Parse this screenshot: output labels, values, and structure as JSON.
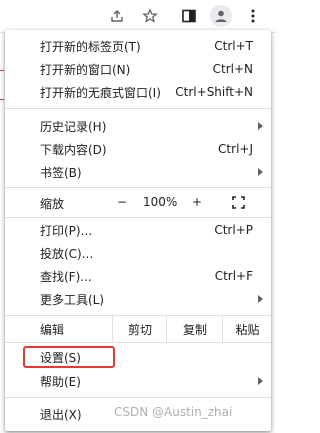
{
  "menu": {
    "new_tab": {
      "label": "打开新的标签页(T)",
      "shortcut": "Ctrl+T"
    },
    "new_window": {
      "label": "打开新的窗口(N)",
      "shortcut": "Ctrl+N"
    },
    "new_incognito": {
      "label": "打开新的无痕式窗口(I)",
      "shortcut": "Ctrl+Shift+N"
    },
    "history": {
      "label": "历史记录(H)"
    },
    "downloads": {
      "label": "下载内容(D)",
      "shortcut": "Ctrl+J"
    },
    "bookmarks": {
      "label": "书签(B)"
    },
    "zoom": {
      "label": "缩放",
      "minus": "−",
      "value": "100%",
      "plus": "+"
    },
    "print": {
      "label": "打印(P)...",
      "shortcut": "Ctrl+P"
    },
    "cast": {
      "label": "投放(C)..."
    },
    "find": {
      "label": "查找(F)...",
      "shortcut": "Ctrl+F"
    },
    "more_tools": {
      "label": "更多工具(L)"
    },
    "edit": {
      "label": "编辑",
      "cut": "剪切",
      "copy": "复制",
      "paste": "粘贴"
    },
    "settings": {
      "label": "设置(S)"
    },
    "help": {
      "label": "帮助(E)"
    },
    "exit": {
      "label": "退出(X)"
    }
  },
  "watermark": "CSDN @Austin_zhai",
  "colors": {
    "highlight": "#e53935",
    "separator": "#e0e0e0",
    "icon": "#5f6368"
  }
}
